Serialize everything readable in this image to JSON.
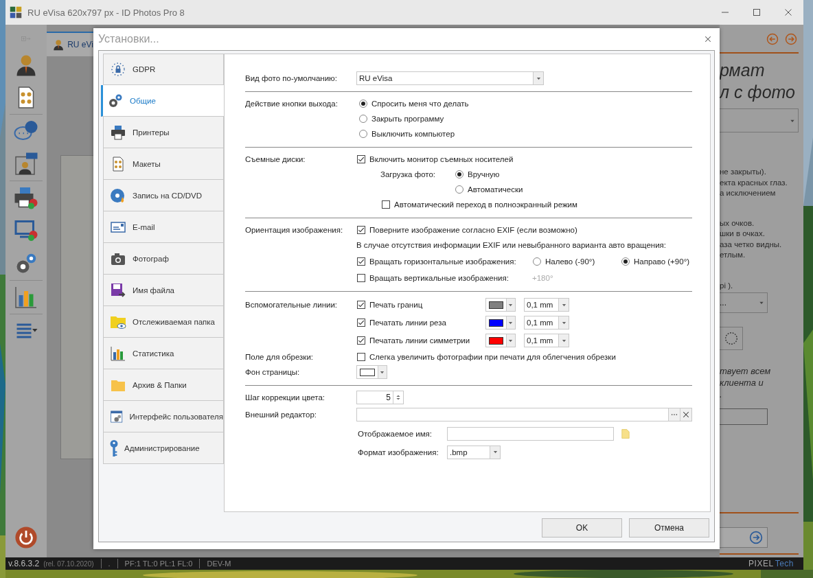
{
  "window": {
    "title": "RU eVisa 620x797 px - ID Photos Pro 8",
    "tab": "RU eVi"
  },
  "background_panel": {
    "heading": [
      "рмат",
      "л с фото"
    ],
    "lines_1": [
      "не закрыты).",
      "екта красных глаз.",
      "а исключением"
    ],
    "lines_2": [
      "ых очков.",
      "шки в очках.",
      "аза четко видны.",
      "етлым."
    ],
    "dpi_note": "pi ).",
    "select_value": "...",
    "note_lines": [
      "твует всем",
      "клиента и",
      "."
    ]
  },
  "dialog": {
    "title": "Установки...",
    "nav": [
      {
        "label": "GDPR",
        "selected": false
      },
      {
        "label": "Общие",
        "selected": true
      },
      {
        "label": "Принтеры",
        "selected": false
      },
      {
        "label": "Макеты",
        "selected": false
      },
      {
        "label": "Запись на CD/DVD",
        "selected": false
      },
      {
        "label": "E-mail",
        "selected": false
      },
      {
        "label": "Фотограф",
        "selected": false
      },
      {
        "label": "Имя файла",
        "selected": false
      },
      {
        "label": "Отслеживаемая папка",
        "selected": false
      },
      {
        "label": "Статистика",
        "selected": false
      },
      {
        "label": "Архив & Папки",
        "selected": false
      },
      {
        "label": "Интерфейс пользователя",
        "selected": false
      },
      {
        "label": "Администрирование",
        "selected": false
      }
    ],
    "default_photo": {
      "label": "Вид фото по-умолчанию:",
      "value": "RU eVisa"
    },
    "exit_action": {
      "label": "Действие кнопки выхода:",
      "options": [
        {
          "label": "Спросить меня что делать",
          "selected": true
        },
        {
          "label": "Закрыть программу",
          "selected": false
        },
        {
          "label": "Выключить компьютер",
          "selected": false
        }
      ]
    },
    "removable": {
      "label": "Съемные диски:",
      "monitor": {
        "label": "Включить монитор съемных носителей",
        "checked": true
      },
      "load_label": "Загрузка фото:",
      "load_options": [
        {
          "label": "Вручную",
          "selected": true
        },
        {
          "label": "Автоматически",
          "selected": false
        }
      ],
      "fullscreen": {
        "label": "Автоматический переход в полноэкранный режим",
        "checked": false
      }
    },
    "orientation": {
      "label": "Ориентация изображения:",
      "exif": {
        "label": "Поверните изображение согласно EXIF (если возможно)",
        "checked": true
      },
      "note": "В случае отсутствия информации EXIF или невыбранного варианта авто вращения:",
      "horizontal": {
        "label": "Вращать горизонтальные изображения:",
        "checked": true,
        "options": [
          {
            "label": "Налево (-90°)",
            "selected": false
          },
          {
            "label": "Направо (+90°)",
            "selected": true
          }
        ]
      },
      "vertical": {
        "label": "Вращать вертикальные изображения:",
        "checked": false,
        "option": "+180°",
        "disabled": true
      }
    },
    "guides": {
      "label": "Вспомогательные линии:",
      "lines": [
        {
          "label": "Печать границ",
          "checked": true,
          "color": "#808080",
          "width": "0,1 mm"
        },
        {
          "label": "Печатать линии реза",
          "checked": true,
          "color": "#0000ff",
          "width": "0,1 mm"
        },
        {
          "label": "Печатать линии симметрии",
          "checked": true,
          "color": "#ff0000",
          "width": "0,1 mm"
        }
      ]
    },
    "crop_margin": {
      "label": "Поле для обрезки:",
      "option": {
        "label": "Слегка увеличить фотографии при печати для облегчения обрезки",
        "checked": false
      }
    },
    "page_background": {
      "label": "Фон страницы:",
      "color": "#ffffff"
    },
    "color_step": {
      "label": "Шаг коррекции цвета:",
      "value": "5"
    },
    "external_editor": {
      "label": "Внешний редактор:",
      "display_name_label": "Отображаемое имя:",
      "format_label": "Формат изображения:",
      "format": ".bmp"
    },
    "buttons": [
      "OK",
      "Отмена"
    ]
  },
  "status_bar": {
    "version": "v.8.6.3.2",
    "release": "(rel. 07.10.2020)",
    "field_3": ".",
    "counters": "PF:1 TL:0 PL:1 FL:0",
    "mode": "DEV-M",
    "logo": [
      "PIXEL",
      "Tech"
    ]
  }
}
